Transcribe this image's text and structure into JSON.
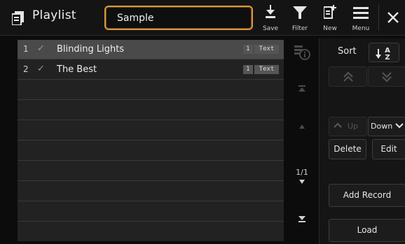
{
  "header": {
    "title": "Playlist",
    "playlist_name": "Sample",
    "buttons": {
      "save": "Save",
      "filter": "Filter",
      "new": "New",
      "menu": "Menu"
    }
  },
  "records": [
    {
      "num": "1",
      "check": "✓",
      "name": "Blinding Lights",
      "count": "1",
      "tag": "Text",
      "selected": true
    },
    {
      "num": "2",
      "check": "✓",
      "name": "The Best",
      "count": "1",
      "tag": "Text",
      "selected": false
    }
  ],
  "scroll": {
    "page_indicator": "1/1",
    "top_icon": "scroll-top-icon",
    "page_up_icon": "page-up-icon",
    "page_down_icon": "page-down-icon",
    "bottom_icon": "scroll-bottom-icon"
  },
  "panel": {
    "sort_label": "Sort",
    "up_label": "Up",
    "down_label": "Down",
    "delete_label": "Delete",
    "edit_label": "Edit",
    "add_record_label": "Add Record",
    "load_label": "Load"
  },
  "colors": {
    "accent": "#d9963b",
    "selected_row": "#4a4a4a",
    "list_bg": "#222222"
  }
}
